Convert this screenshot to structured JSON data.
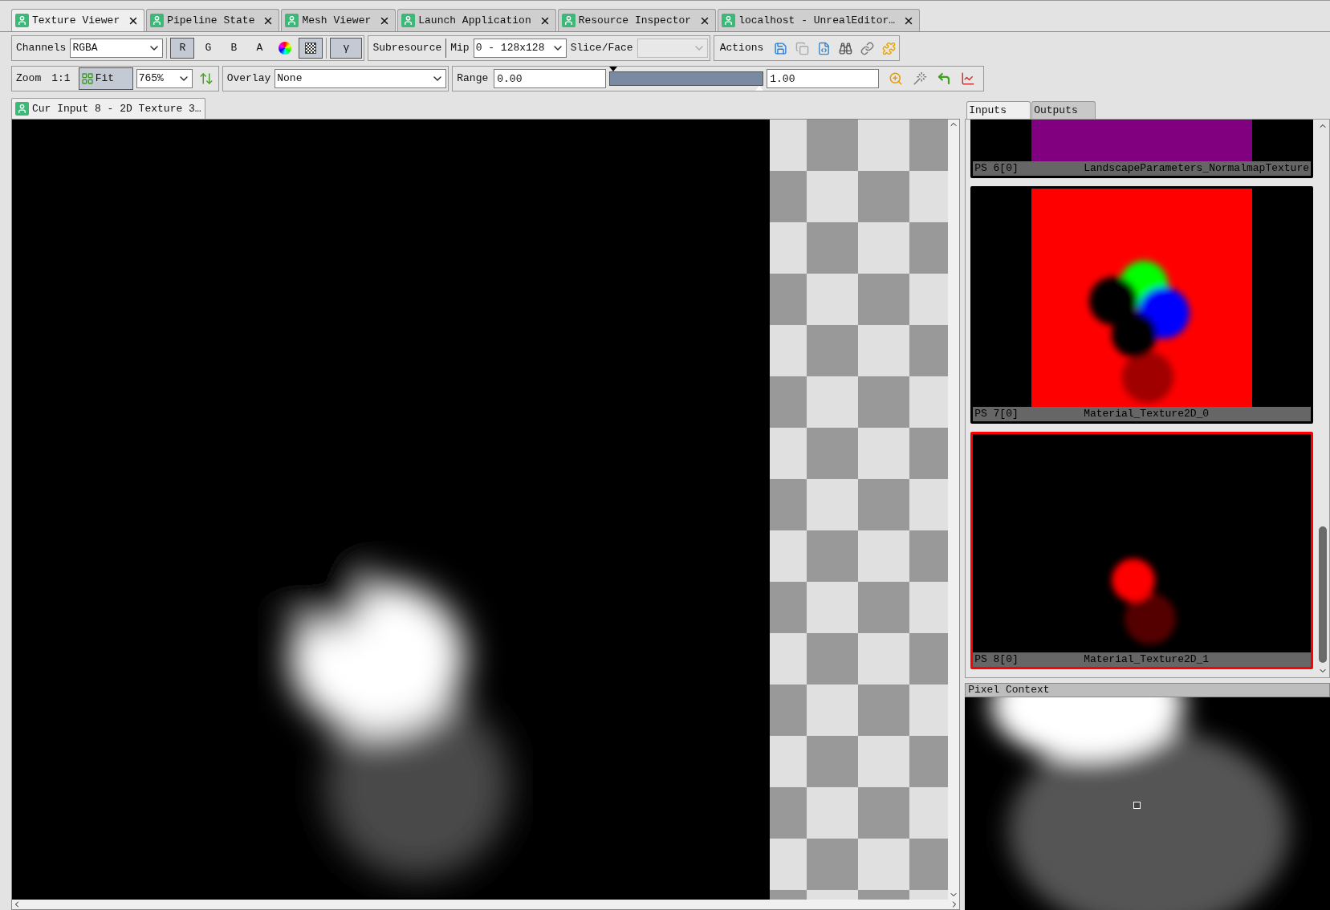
{
  "tabs": [
    {
      "label": "Texture Viewer",
      "selected": true
    },
    {
      "label": "Pipeline State",
      "selected": false
    },
    {
      "label": "Mesh Viewer",
      "selected": false
    },
    {
      "label": "Launch Application",
      "selected": false
    },
    {
      "label": "Resource Inspector",
      "selected": false
    },
    {
      "label": "localhost - UnrealEditor…",
      "selected": false
    }
  ],
  "toolbar": {
    "channels_label": "Channels",
    "channels_value": "RGBA",
    "channel_buttons": [
      {
        "label": "R",
        "selected": true
      },
      {
        "label": "G",
        "selected": false
      },
      {
        "label": "B",
        "selected": false
      },
      {
        "label": "A",
        "selected": false
      }
    ],
    "checkerboard_selected": true,
    "gamma": {
      "label": "γ",
      "selected": true
    },
    "subresource_label": "Subresource",
    "mip_label": "Mip",
    "mip_value": "0 - 128x128",
    "slice_label": "Slice/Face",
    "slice_select": {
      "disabled": true
    },
    "actions_label": "Actions"
  },
  "view_bar": {
    "zoom_label": "Zoom",
    "one_to_one": "1:1",
    "fit": {
      "label": "Fit",
      "selected": true
    },
    "zoom_value": "765%",
    "overlay_label": "Overlay",
    "overlay_value": "None",
    "range_label": "Range",
    "range_min": "0.00",
    "range_slider": {
      "level": 1
    },
    "range_max": "1.00"
  },
  "document_tab": {
    "label": "Cur Input 8 - 2D Texture 3…"
  },
  "resource_tabs": [
    {
      "label": "Inputs",
      "selected": true
    },
    {
      "label": "Outputs",
      "selected": false
    }
  ],
  "thumbnails": [
    {
      "slot": "PS 6[0]",
      "name": "LandscapeParameters_NormalmapTexture",
      "kind": "flat",
      "selected": false
    },
    {
      "slot": "PS 7[0]",
      "name": "Material_Texture2D_0",
      "kind": "blobs",
      "selected": false
    },
    {
      "slot": "PS 8[0]",
      "name": "Material_Texture2D_1",
      "kind": "glow",
      "selected": true
    }
  ],
  "pixel_context": {
    "title": "Pixel Context"
  }
}
